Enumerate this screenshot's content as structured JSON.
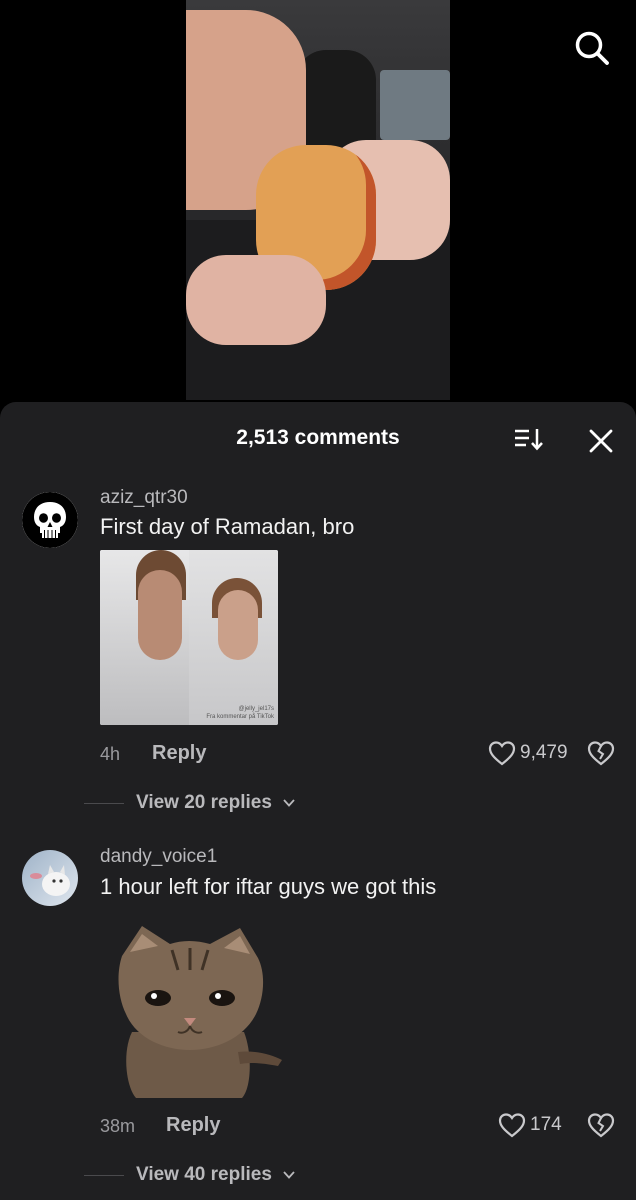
{
  "app": {
    "search_icon": "search-icon"
  },
  "video": {
    "description": "video-frame"
  },
  "comments_sheet": {
    "count_label": "2,513 comments",
    "sort_icon": "sort-icon",
    "close_icon": "close-icon"
  },
  "comments": [
    {
      "username": "aziz_qtr30",
      "text": "First day of Ramadan, bro",
      "media_watermark_1": "@jelly_jel17s",
      "media_watermark_2": "Fra kommentar på TikTok",
      "time": "4h",
      "reply_label": "Reply",
      "likes": "9,479",
      "view_replies": "View 20 replies"
    },
    {
      "username": "dandy_voice1",
      "text": "1 hour left for iftar guys we got this",
      "time": "38m",
      "reply_label": "Reply",
      "likes": "174",
      "view_replies": "View 40 replies"
    }
  ],
  "colors": {
    "sheet_bg": "#1f1f21",
    "text_primary": "#f2f2f2",
    "text_secondary": "#b9b9bc"
  }
}
